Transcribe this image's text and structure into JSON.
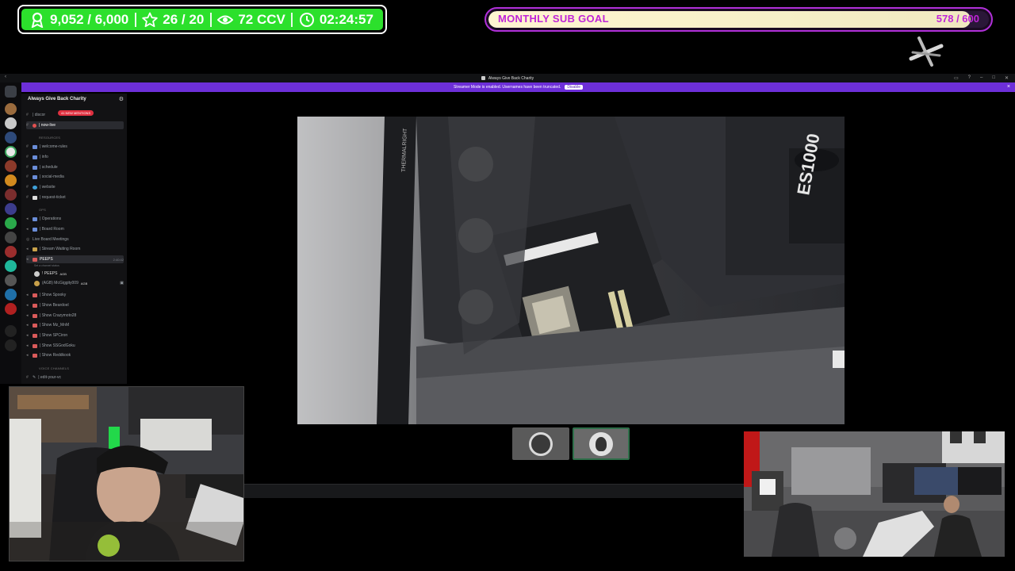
{
  "stats": {
    "followers": "9,052 / 6,000",
    "subs": "26 / 20",
    "viewers": "72 CCV",
    "uptime": "02:24:57",
    "accent": "#2ce02c"
  },
  "sub_goal": {
    "label": "MONTHLY SUB GOAL",
    "value": "578 / 600",
    "progress": 0.963,
    "accent": "#c024d8"
  },
  "discord": {
    "window_title": "Always Give Back Charity",
    "banner_text": "Streamer Mode is enabled. Usernames have been truncated.",
    "banner_button": "Disable",
    "server_name": "Always Give Back Charity",
    "mentions_badge": "41 NEW MENTIONS",
    "channels_top": [
      {
        "label": "| discor"
      },
      {
        "label": "| now-live"
      }
    ],
    "cat_resources": "RESOURCES",
    "resources": [
      {
        "label": "| welcome-rules"
      },
      {
        "label": "| info"
      },
      {
        "label": "| schedule"
      },
      {
        "label": "| social-media"
      },
      {
        "label": "| website"
      },
      {
        "label": "| request-ticket"
      }
    ],
    "cat_ops": "OPS",
    "ops": [
      {
        "label": "| Operations"
      },
      {
        "label": "| Board Room"
      },
      {
        "label": "Live Board Meetings"
      },
      {
        "label": "| Stream Waiting Room"
      },
      {
        "label": "PEEPS",
        "time": "2:40:42"
      }
    ],
    "set_status": "Set a channel status",
    "peeps_members": [
      {
        "label": "! PEEPS",
        "tag": "AGB"
      },
      {
        "label": "(AGB) McGiggity009",
        "tag": "AGB"
      }
    ],
    "shows": [
      {
        "label": "| Show Spooky"
      },
      {
        "label": "| Show Beardoel"
      },
      {
        "label": "| Show Crazymoto28"
      },
      {
        "label": "| Show Mz_MnM"
      },
      {
        "label": "| Show SPCiron"
      },
      {
        "label": "| Show SSGodGoku"
      },
      {
        "label": "| Show Reddkook"
      }
    ],
    "cat_voice": "VOICE CHANNELS",
    "voice": [
      {
        "label": "| edit-your-vc"
      }
    ]
  },
  "video": {
    "case_text": "THERMALRIGHT",
    "psu_text": "ES1000"
  }
}
